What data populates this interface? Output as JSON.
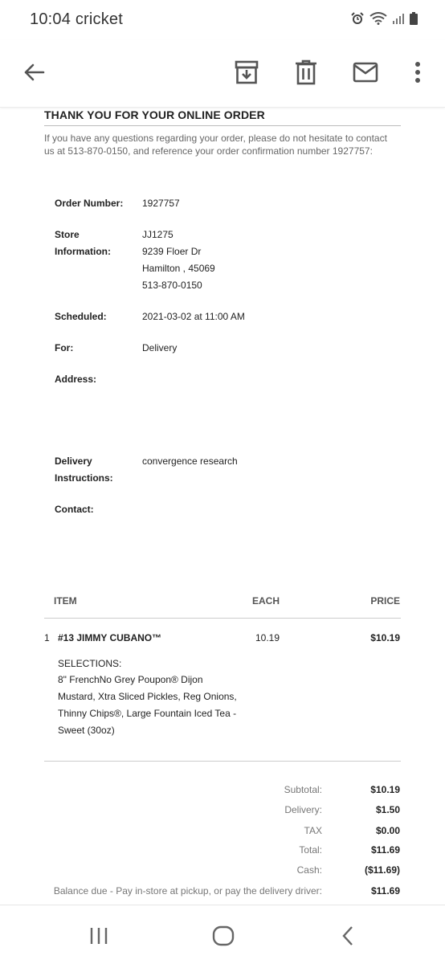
{
  "status_bar": {
    "time": "10:04",
    "carrier": "cricket",
    "icons": [
      "alarm-icon",
      "wifi-icon",
      "signal-icon",
      "battery-icon"
    ]
  },
  "toolbar": {
    "icons": [
      "back-arrow-icon",
      "archive-icon",
      "delete-icon",
      "mail-icon",
      "more-vert-icon"
    ]
  },
  "email": {
    "heading": "THANK YOU FOR YOUR ONLINE ORDER",
    "intro": "If you have any questions regarding your order, please do not hesitate to contact us at 513-870-0150, and reference your order confirmation number 1927757:",
    "order_number_label": "Order Number:",
    "order_number": "1927757",
    "store_label_1": "Store",
    "store_label_2": "Information:",
    "store_lines": [
      "JJ1275",
      "9239 Floer Dr",
      "Hamilton , 45069",
      "513-870-0150"
    ],
    "scheduled_label": "Scheduled:",
    "scheduled": "2021-03-02 at 11:00 AM",
    "for_label": "For:",
    "for": "Delivery",
    "address_label": "Address:",
    "delivery_label_1": "Delivery",
    "delivery_label_2": "Instructions:",
    "delivery_instructions": "convergence research",
    "contact_label": "Contact:",
    "table": {
      "headers": [
        "ITEM",
        "EACH",
        "PRICE"
      ],
      "items": [
        {
          "qty": "1",
          "name": "#13 JIMMY CUBANO™",
          "each": "10.19",
          "price": "$10.19",
          "selections_label": "SELECTIONS:",
          "selections": "8\" FrenchNo Grey Poupon® Dijon Mustard, Xtra Sliced Pickles, Reg Onions, Thinny Chips®, Large Fountain Iced Tea - Sweet (30oz)"
        }
      ]
    },
    "totals": [
      {
        "label": "Subtotal:",
        "value": "$10.19"
      },
      {
        "label": "Delivery:",
        "value": "$1.50"
      },
      {
        "label": "TAX",
        "value": "$0.00"
      },
      {
        "label": "Total:",
        "value": "$11.69"
      },
      {
        "label": "Cash:",
        "value": "($11.69)"
      },
      {
        "label": "Balance due - Pay in-store at pickup, or pay the delivery driver:",
        "value": "$11.69"
      }
    ]
  },
  "navbar": {
    "icons": [
      "recent-apps-icon",
      "home-icon",
      "back-icon"
    ]
  }
}
